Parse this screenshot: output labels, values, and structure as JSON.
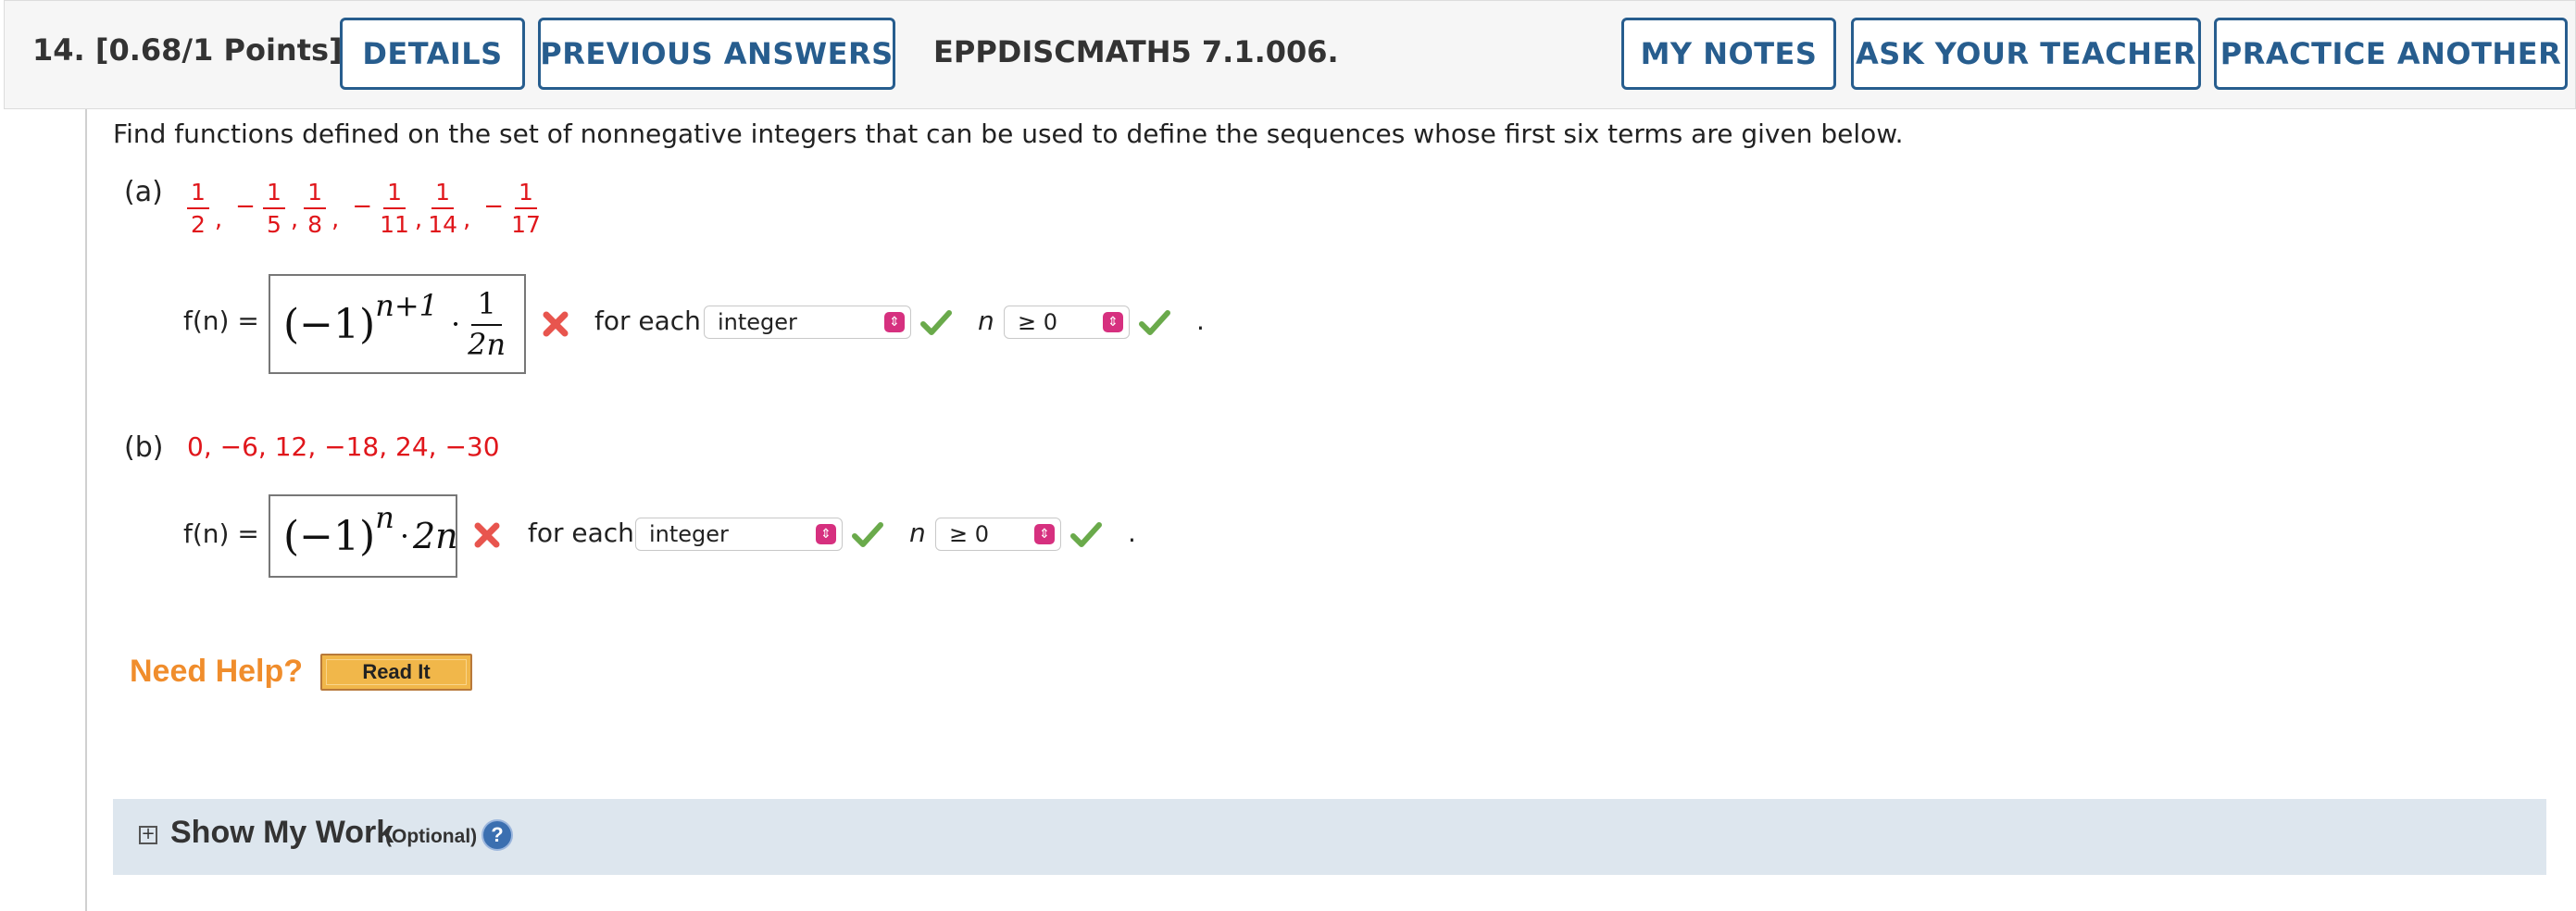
{
  "header": {
    "question_number": "14.",
    "points": "[0.68/1 Points]",
    "details_label": "DETAILS",
    "previous_answers_label": "PREVIOUS ANSWERS",
    "problem_code": "EPPDISCMATH5 7.1.006.",
    "my_notes_label": "MY NOTES",
    "ask_teacher_label": "ASK YOUR TEACHER",
    "practice_another_label": "PRACTICE ANOTHER"
  },
  "prompt": "Find functions defined on the set of nonnegative integers that can be used to define the sequences whose first six terms are given below.",
  "part_a": {
    "label": "(a)",
    "sequence": [
      {
        "sign": "",
        "num": "1",
        "den": "2"
      },
      {
        "sign": "−",
        "num": "1",
        "den": "5"
      },
      {
        "sign": "",
        "num": "1",
        "den": "8"
      },
      {
        "sign": "−",
        "num": "1",
        "den": "11"
      },
      {
        "sign": "",
        "num": "1",
        "den": "14"
      },
      {
        "sign": "−",
        "num": "1",
        "den": "17"
      }
    ],
    "fn_label": "f(n) =",
    "answer": {
      "base": "(−1)",
      "exp": "n+1",
      "dot": "·",
      "frac_num": "1",
      "frac_den": "2n"
    },
    "for_each": "for each",
    "select1_value": "integer",
    "n_label": "n",
    "select2_value": "≥ 0",
    "period": "."
  },
  "part_b": {
    "label": "(b)",
    "sequence_text": "0, −6, 12, −18, 24, −30",
    "fn_label": "f(n) =",
    "answer": {
      "base": "(−1)",
      "exp": "n",
      "dot": "·",
      "term": "2n"
    },
    "for_each": "for each",
    "select1_value": "integer",
    "n_label": "n",
    "select2_value": "≥ 0",
    "period": "."
  },
  "help": {
    "need_help": "Need Help?",
    "read_it": "Read It"
  },
  "show_work": {
    "plus": "+",
    "title": "Show My Work",
    "optional": "(Optional)",
    "help_icon": "?"
  },
  "colors": {
    "accent_blue": "#275d8e",
    "error_red": "#e0161b",
    "help_orange": "#f08d2c",
    "check_green": "#6aaa4b",
    "select_pink": "#d6307f"
  }
}
